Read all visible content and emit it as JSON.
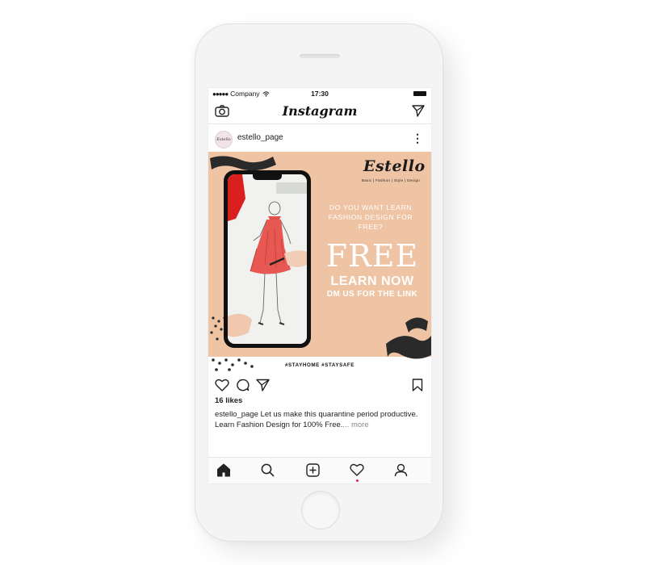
{
  "status_bar": {
    "carrier": "Company",
    "signal_dots": "●●●●●",
    "time": "17:30"
  },
  "app": {
    "title": "Instagram"
  },
  "post": {
    "username": "estello_page",
    "avatar_label": "Estello",
    "image": {
      "brand": "Estello",
      "brand_tagline": "Basic | Fashion | Style | Design",
      "question": "DO YOU WANT LEARN FASHION DESIGN FOR FREE?",
      "headline": "FREE",
      "cta": "LEARN NOW",
      "sub_cta": "DM US FOR THE LINK",
      "hashtags": "#STAYHOME #STAYSAFE",
      "colors": {
        "background": "#efc4a4",
        "accent_dark": "#2a2a2a"
      }
    },
    "likes": "16 likes",
    "caption_user": "estello_page",
    "caption_text": "Let us make this quarantine period productive. Learn Fashion Design for 100% Free.",
    "caption_more": "... more"
  },
  "icons": {
    "header": [
      "camera-icon",
      "direct-message-icon"
    ],
    "post_actions": [
      "heart-icon",
      "comment-icon",
      "share-icon",
      "bookmark-icon"
    ],
    "tabbar": [
      "home-icon",
      "search-icon",
      "add-post-icon",
      "activity-heart-icon",
      "profile-icon"
    ]
  }
}
